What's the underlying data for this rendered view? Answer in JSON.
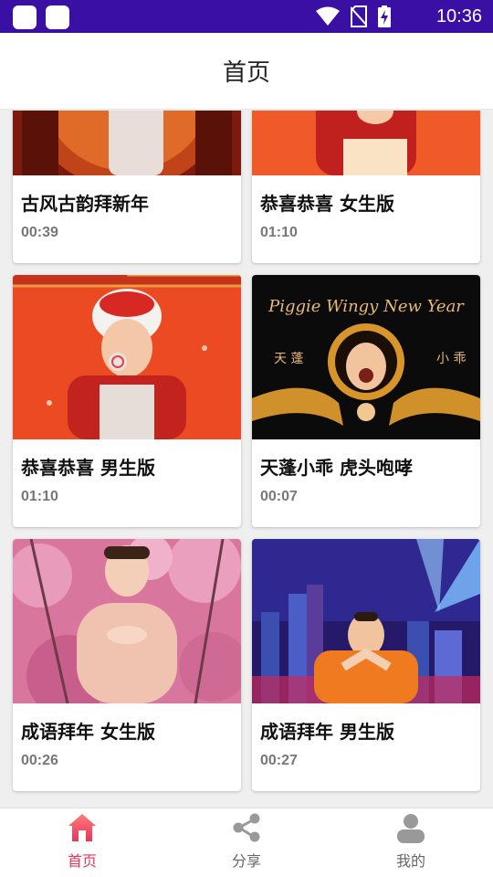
{
  "status_bar": {
    "time": "10:36"
  },
  "header": {
    "title": "首页"
  },
  "videos": [
    {
      "title": "古风古韵拜新年",
      "duration": "00:39"
    },
    {
      "title": "恭喜恭喜 女生版",
      "duration": "01:10"
    },
    {
      "title": "恭喜恭喜 男生版",
      "duration": "01:10"
    },
    {
      "title": "天蓬小乖 虎头咆哮",
      "duration": "00:07"
    },
    {
      "title": "成语拜年 女生版",
      "duration": "00:26"
    },
    {
      "title": "成语拜年 男生版",
      "duration": "00:27"
    }
  ],
  "thumb_texts": {
    "logo": "Piggie Wingy New Year",
    "left": "天 蓬",
    "right": "小 乖"
  },
  "nav": [
    {
      "label": "首页",
      "icon": "home-icon",
      "active": true
    },
    {
      "label": "分享",
      "icon": "share-icon",
      "active": false
    },
    {
      "label": "我的",
      "icon": "profile-icon",
      "active": false
    }
  ],
  "colors": {
    "status_bar": "#3a0fa3",
    "accent": "#e8365c"
  }
}
